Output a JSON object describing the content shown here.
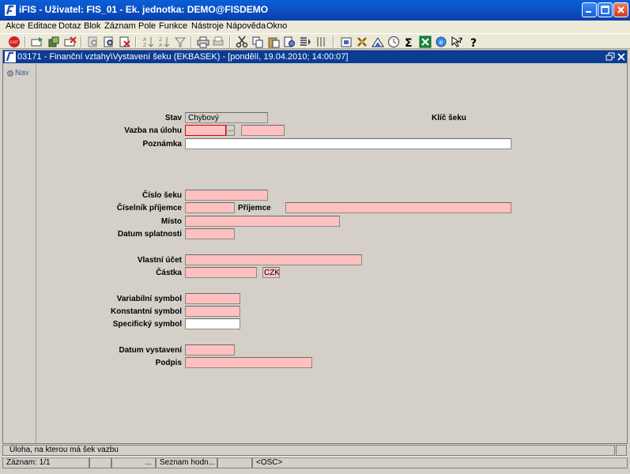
{
  "window": {
    "title": "iFIS - Uživatel: FIS_01 - Ek. jednotka: DEMO@FISDEMO"
  },
  "menu": [
    "Akce",
    "Editace",
    "Dotaz",
    "Blok",
    "Záznam",
    "Pole",
    "Funkce",
    "Nástroje",
    "Nápověda",
    "Okno"
  ],
  "inner_window": {
    "title": "03171 - Finanční vztahy\\Vystavení šeku (EKBASEK) - [pondělí, 19.04.2010; 14:00:07]"
  },
  "left_panel": {
    "nav_label": "Nav"
  },
  "form": {
    "stav_label": "Stav",
    "stav_value": "Chybový",
    "klic_seku_label": "Klíč šeku",
    "vazba_label": "Vazba na úlohu",
    "lov_button": "...",
    "poznamka_label": "Poznámka",
    "cislo_seku_label": "Číslo šeku",
    "ciselnik_prijemce_label": "Číselník příjemce",
    "prijemce_label": "Příjemce",
    "misto_label": "Místo",
    "datum_splatnosti_label": "Datum splatnosti",
    "vlastni_ucet_label": "Vlastní účet",
    "castka_label": "Částka",
    "mena_value": "CZK",
    "variabilni_label": "Variabilní symbol",
    "konstantni_label": "Konstantní symbol",
    "specificky_label": "Specifický symbol",
    "datum_vystaveni_label": "Datum vystavení",
    "podpis_label": "Podpis"
  },
  "hint": "Úloha, na kterou má šek vazbu",
  "status": {
    "record": "Záznam: 1/1",
    "cell3": "...",
    "list": "Seznam hodn...",
    "mode": "<OSC>"
  },
  "colors": {
    "titlebar": "#0b4fc2",
    "required_field": "#ffc0c0",
    "inner_title": "#0b3c93"
  }
}
